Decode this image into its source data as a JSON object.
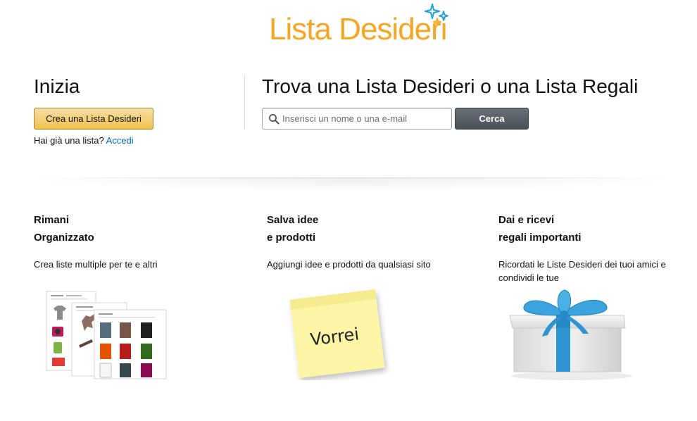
{
  "logo": {
    "text": "Lista Desideri",
    "color": "#f5a623",
    "sparkle_colors": [
      "#1aa1d6",
      "#f5a623"
    ]
  },
  "start": {
    "title": "Inizia",
    "create_button": "Crea una Lista Desideri",
    "have_list_text": "Hai già una lista?",
    "have_list_link": "Accedi"
  },
  "find": {
    "title": "Trova una Lista Desideri o una Lista Regali",
    "search": {
      "placeholder": "Inserisci un nome o una e-mail",
      "value": ""
    },
    "search_button": "Cerca"
  },
  "features": [
    {
      "title_line1": "Rimani",
      "title_line2": "Organizzato",
      "description": "Crea liste multiple per te e altri",
      "illustration": "stacked-lists-icon"
    },
    {
      "title_line1": "Salva idee",
      "title_line2": "e prodotti",
      "description": "Aggiungi idee e prodotti da qualsiasi sito",
      "illustration": "sticky-note-icon",
      "note_text": "Vorrei"
    },
    {
      "title_line1": "Dai e ricevi",
      "title_line2": "regali importanti",
      "description_line1": "Ricordati le Liste Desideri dei tuoi amici e",
      "description_line2": "condividi le tue",
      "illustration": "gift-box-icon"
    }
  ],
  "colors": {
    "accent_button": "#f0c14b",
    "link": "#0066c0",
    "search_button": "#4a5057",
    "ribbon": "#2f95d1",
    "note": "#fdf5a6"
  }
}
